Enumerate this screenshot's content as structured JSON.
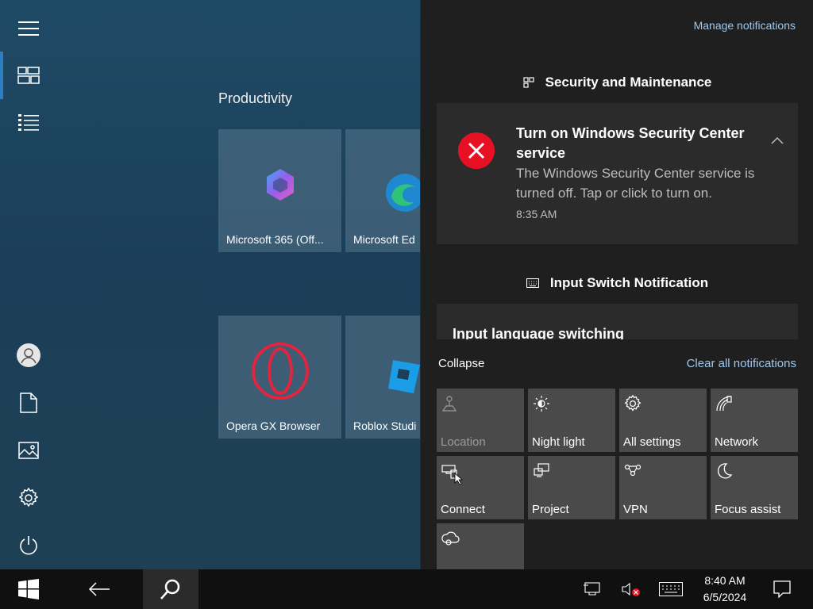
{
  "start": {
    "group_title": "Productivity",
    "tiles": [
      {
        "label": "Microsoft 365 (Off...",
        "icon": "microsoft-365-icon"
      },
      {
        "label": "Microsoft Ed",
        "icon": "edge-icon"
      },
      {
        "label": "Opera GX Browser",
        "icon": "opera-gx-icon"
      },
      {
        "label": "Roblox Studi",
        "icon": "roblox-studio-icon"
      }
    ],
    "rail_icons": [
      "hamburger-menu-icon",
      "tiles-icon",
      "all-apps-list-icon",
      "user-icon",
      "documents-icon",
      "pictures-icon",
      "settings-gear-icon",
      "power-icon"
    ]
  },
  "action_center": {
    "manage_label": "Manage notifications",
    "groups": [
      {
        "header": "Security and Maintenance",
        "notification": {
          "title": "Turn on Windows Security Center service",
          "body": "The Windows Security Center service is turned off. Tap or click to turn on.",
          "time": "8:35 AM"
        }
      },
      {
        "header": "Input Switch Notification",
        "notification": {
          "title": "Input language switching"
        }
      }
    ],
    "collapse_label": "Collapse",
    "clear_label": "Clear all notifications",
    "quick_actions": [
      {
        "label": "Location",
        "icon": "location-icon",
        "enabled": false
      },
      {
        "label": "Night light",
        "icon": "night-light-icon",
        "enabled": true
      },
      {
        "label": "All settings",
        "icon": "gear-icon",
        "enabled": true
      },
      {
        "label": "Network",
        "icon": "network-icon",
        "enabled": true
      },
      {
        "label": "Connect",
        "icon": "connect-icon",
        "enabled": true
      },
      {
        "label": "Project",
        "icon": "project-icon",
        "enabled": true
      },
      {
        "label": "VPN",
        "icon": "vpn-icon",
        "enabled": true
      },
      {
        "label": "Focus assist",
        "icon": "focus-assist-icon",
        "enabled": true
      },
      {
        "label": "",
        "icon": "ambient-icon",
        "enabled": true
      }
    ]
  },
  "taskbar": {
    "time": "8:40 AM",
    "date": "6/5/2024"
  },
  "colors": {
    "accent": "#2d7fc1",
    "link": "#9fc8ec",
    "error": "#e81123"
  }
}
